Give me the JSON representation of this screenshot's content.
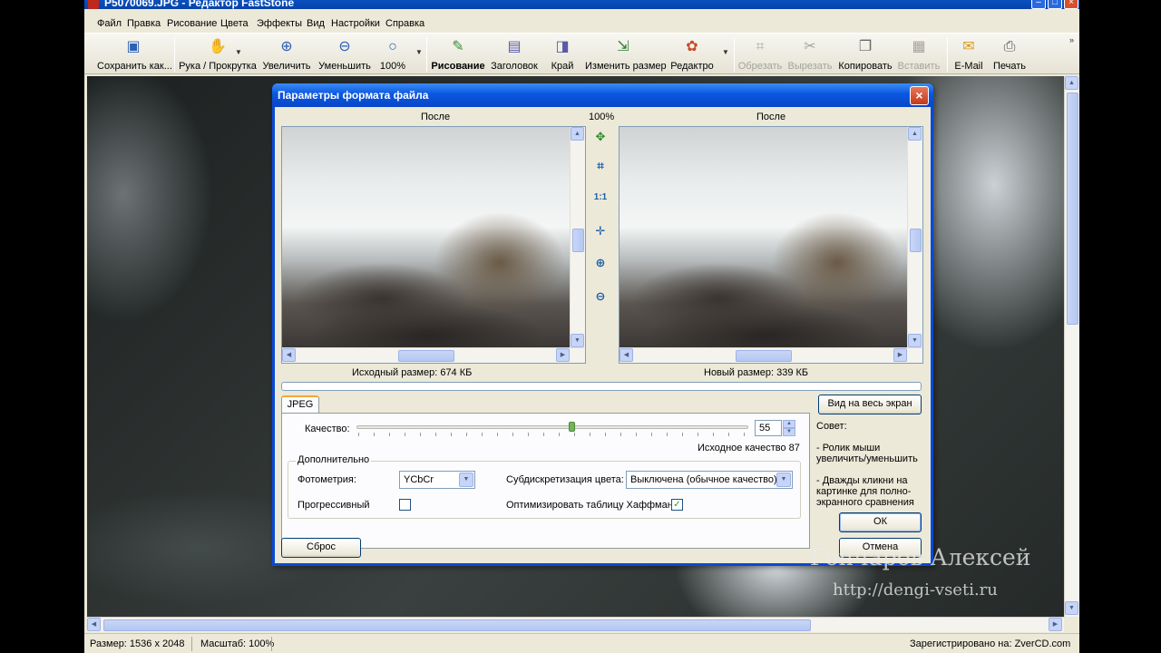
{
  "window": {
    "title": "P5070069.JPG - Редактор FastStone"
  },
  "menu": [
    "Файл",
    "Правка",
    "Рисование",
    "Цвета",
    "Эффекты",
    "Вид",
    "Настройки",
    "Справка"
  ],
  "toolbar": {
    "save_as": "Сохранить как...",
    "hand_scroll": "Рука / Прокрутка",
    "zoom_in": "Увеличить",
    "zoom_out": "Уменьшить",
    "zoom_level": "100%",
    "draw": "Рисование",
    "caption": "Заголовок",
    "border": "Край",
    "resize": "Изменить размер",
    "editor": "Редактро",
    "crop": "Обрезать",
    "cut": "Вырезать",
    "copy": "Копировать",
    "paste": "Вставить",
    "email": "E-Mail",
    "print": "Печать"
  },
  "statusbar": {
    "size": "Размер: 1536 x 2048",
    "scale": "Масштаб: 100%",
    "registered": "Зарегистрировано на: ZverCD.com"
  },
  "dialog": {
    "title": "Параметры формата файла",
    "left_preview_label": "После",
    "zoom_label": "100%",
    "right_preview_label": "После",
    "original_size": "Исходный размер:  674 КБ",
    "new_size": "Новый размер:  339 КБ",
    "tab_jpeg": "JPEG",
    "fullscreen_button": "Вид на весь экран",
    "quality_label": "Качество:",
    "quality_value": "55",
    "original_quality": "Исходное качество 87",
    "advanced_group": "Дополнительно",
    "photometry_label": "Фотометрия:",
    "photometry_value": "YCbCr",
    "subsampling_label": "Субдискретизация цвета:",
    "subsampling_value": "Выключена (обычное качество)",
    "progressive_label": "Прогрессивный",
    "optimize_huffman_label": "Оптимизировать таблицу Хаффмана",
    "tips_title": "Совет:",
    "tip1": "- Ролик мыши увеличить/уменьшить",
    "tip2": "- Дважды кликни на картинке для полно-экранного сравнения",
    "ok_button": "ОК",
    "cancel_button": "Отмена",
    "reset_button": "Сброс",
    "tool_fit": "1:1"
  },
  "watermark": {
    "name": "Гончаров Алексей",
    "url": "http://dengi-vseti.ru"
  }
}
